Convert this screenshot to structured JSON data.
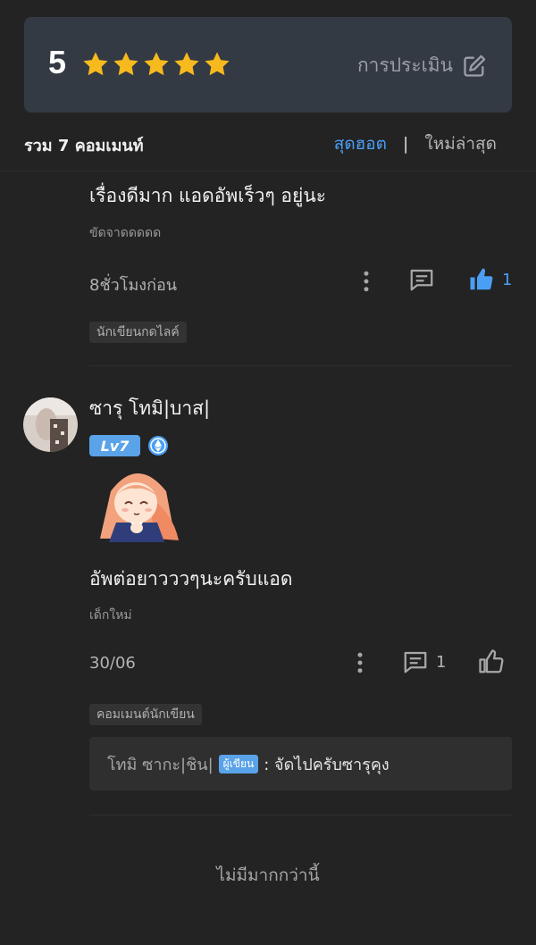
{
  "rating": {
    "score": "5",
    "star_count": 5,
    "star_color": "#f6b91e",
    "rate_label": "การประเมิน"
  },
  "summary": {
    "total": "รวม 7 คอมเมนท์",
    "sort_hot": "สุดฮอต",
    "sort_sep": "|",
    "sort_new": "ใหม่ล่าสุด"
  },
  "comment1": {
    "text": "เรื่องดีมาก แอดอัพเร็วๆ อยู่นะ",
    "user_title": "ขัดจาดดดดด",
    "time": "8ชั่วโมงก่อน",
    "like_count": "1",
    "tag": "นักเขียนกดไลค์"
  },
  "comment2": {
    "username": "ซารุ โทมิ|บาส|",
    "level": "Lv7",
    "text": "อัพต่อยาวววๆนะครับแอด",
    "user_title": "เด็กใหม่",
    "time": "30/06",
    "reply_count": "1",
    "tag": "คอมเมนต์นักเขียน",
    "reply": {
      "author": "โทมิ ซากะ|ชิน|",
      "badge": "ผู้เขียน",
      "text": ": จัดไปครับซารุคุง"
    }
  },
  "footer": {
    "no_more": "ไม่มีมากกว่านี้"
  },
  "colors": {
    "accent": "#4a9ff5",
    "badge": "#5aa3e8",
    "background": "#232323",
    "card": "#333a43"
  }
}
